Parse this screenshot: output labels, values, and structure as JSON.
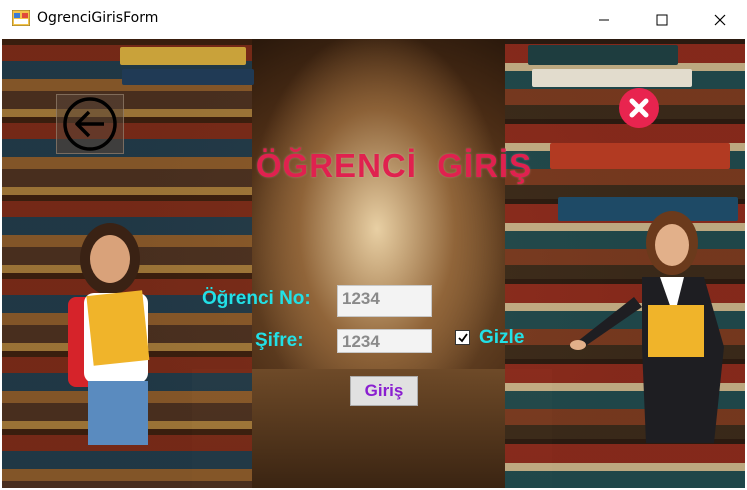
{
  "window": {
    "title": "OgrenciGirisForm",
    "icon": "app-form-icon",
    "controls": [
      "minimize-icon",
      "maximize-icon",
      "close-icon"
    ]
  },
  "form": {
    "heading": "ÖĞRENCİ  GİRİŞ",
    "student_no_label": "Öğrenci No:",
    "student_no_value": "1234",
    "password_label": "Şifre:",
    "password_value": "1234",
    "hide_label": "Gizle",
    "hide_checked": true,
    "submit_label": "Giriş"
  },
  "graphics": {
    "back_icon": "arrow-left-circle-icon",
    "close_icon": "red-x-circle-icon",
    "background": "library-bookshelves-image"
  },
  "colors": {
    "heading": "#e0214f",
    "labels": "#22e0e6",
    "submit_text": "#8a1fd0",
    "close_badge": "#e8244f"
  }
}
